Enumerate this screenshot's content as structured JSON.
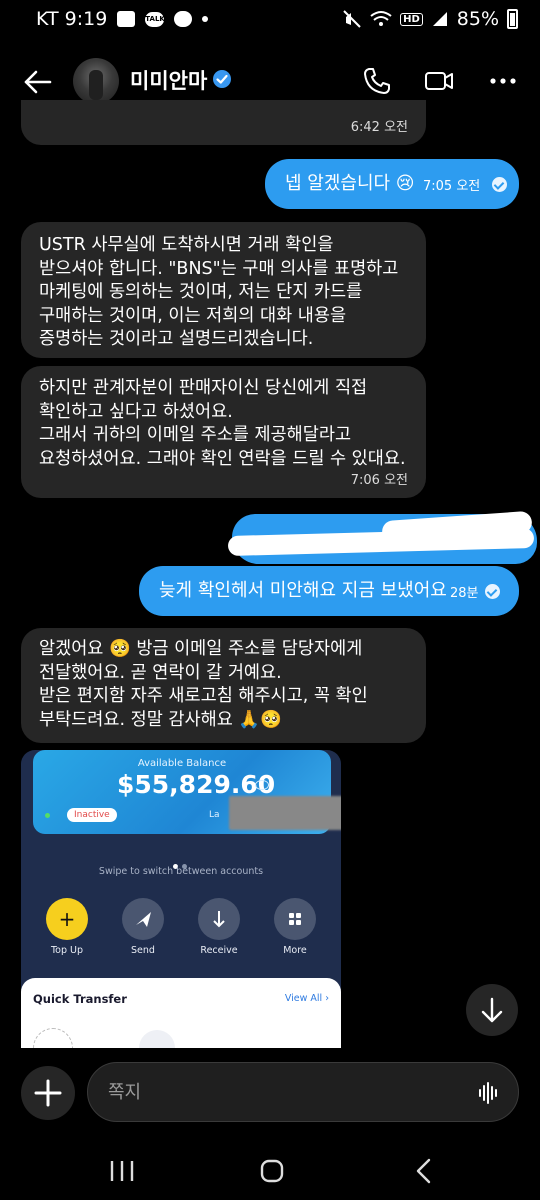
{
  "status_bar": {
    "carrier_time": "KT 9:19",
    "talk_badge": "TALK",
    "hd_label": "HD",
    "battery": "85%"
  },
  "header": {
    "contact_name": "미미안마",
    "verified": true,
    "icons": [
      "back-arrow-icon",
      "avatar",
      "verified-badge-icon",
      "phone-icon",
      "video-camera-icon",
      "more-icon"
    ]
  },
  "messages": [
    {
      "side": "incoming",
      "text": "",
      "time": "6:42 오전"
    },
    {
      "side": "outgoing",
      "text": "넵 알겠습니다 😢",
      "time": "7:05 오전"
    },
    {
      "side": "incoming",
      "text": "USTR 사무실에 도착하시면 거래 확인을 받으셔야 합니다. \"BNS\"는 구매 의사를 표명하고 마케팅에 동의하는 것이며, 저는 단지 카드를 구매하는 것이며, 이는 저희의 대화 내용을 증명하는 것이라고 설명드리겠습니다.",
      "time": ""
    },
    {
      "side": "incoming",
      "text": "하지만 관계자분이 판매자이신 당신에게 직접 확인하고 싶다고 하셨어요. 그래서 귀하의 이메일 주소를 제공해달라고 요청하셨어요. 그래야 확인 연락을 드릴 수 있대요.",
      "time": "7:06 오전"
    },
    {
      "side": "outgoing",
      "text": "",
      "time": ""
    },
    {
      "side": "outgoing",
      "text": "늦게 확인헤서 미안해요 지금 보냈어요",
      "time": "28분"
    },
    {
      "side": "incoming",
      "text": "알겠어요 🥺 방금 이메일 주소를 담당자에게 전달했어요. 곧 연락이 갈 거예요. 받은 편지함 자주 새로고침 해주시고, 꼭 확인 부탁드려요. 정말 감사해요 🙏🥺",
      "time": ""
    }
  ],
  "message_lines": {
    "m2": [
      "USTR 사무실에 도착하시면 거래 확인을",
      "받으셔야 합니다. \"BNS\"는 구매 의사를 표명하고",
      "마케팅에 동의하는 것이며, 저는 단지 카드를",
      "구매하는 것이며, 이는 저희의 대화 내용을",
      "증명하는 것이라고 설명드리겠습니다."
    ],
    "m3": [
      "하지만 관계자분이 판매자이신 당신에게 직접",
      "확인하고 싶다고 하셨어요.",
      "그래서 귀하의 이메일 주소를 제공해달라고",
      "요청하셨어요. 그래야 확인 연락을 드릴 수 있대요."
    ],
    "m6": [
      "알겠어요 🥺 방금 이메일 주소를 담당자에게",
      "전달했어요. 곧 연락이 갈 거예요.",
      "받은 편지함 자주 새로고침 해주시고, 꼭 확인",
      "부탁드려요. 정말 감사해요 🙏🥺"
    ]
  },
  "shared_screenshot": {
    "balance_label": "Available Balance",
    "balance_amount": "$55,829.60",
    "status_pill": "Inactive",
    "last_partial": "La",
    "pager_hint": "Swipe to switch between accounts",
    "actions": [
      {
        "label": "Top Up",
        "icon": "plus-icon"
      },
      {
        "label": "Send",
        "icon": "send-icon"
      },
      {
        "label": "Receive",
        "icon": "download-icon"
      },
      {
        "label": "More",
        "icon": "grid-icon"
      }
    ],
    "quick_transfer_title": "Quick Transfer",
    "view_all": "View All"
  },
  "composer": {
    "placeholder": "쪽지"
  },
  "colors": {
    "outgoing_bubble": "#2d9cf0",
    "incoming_bubble": "#262626",
    "background": "#000000",
    "verified": "#3897f0"
  }
}
